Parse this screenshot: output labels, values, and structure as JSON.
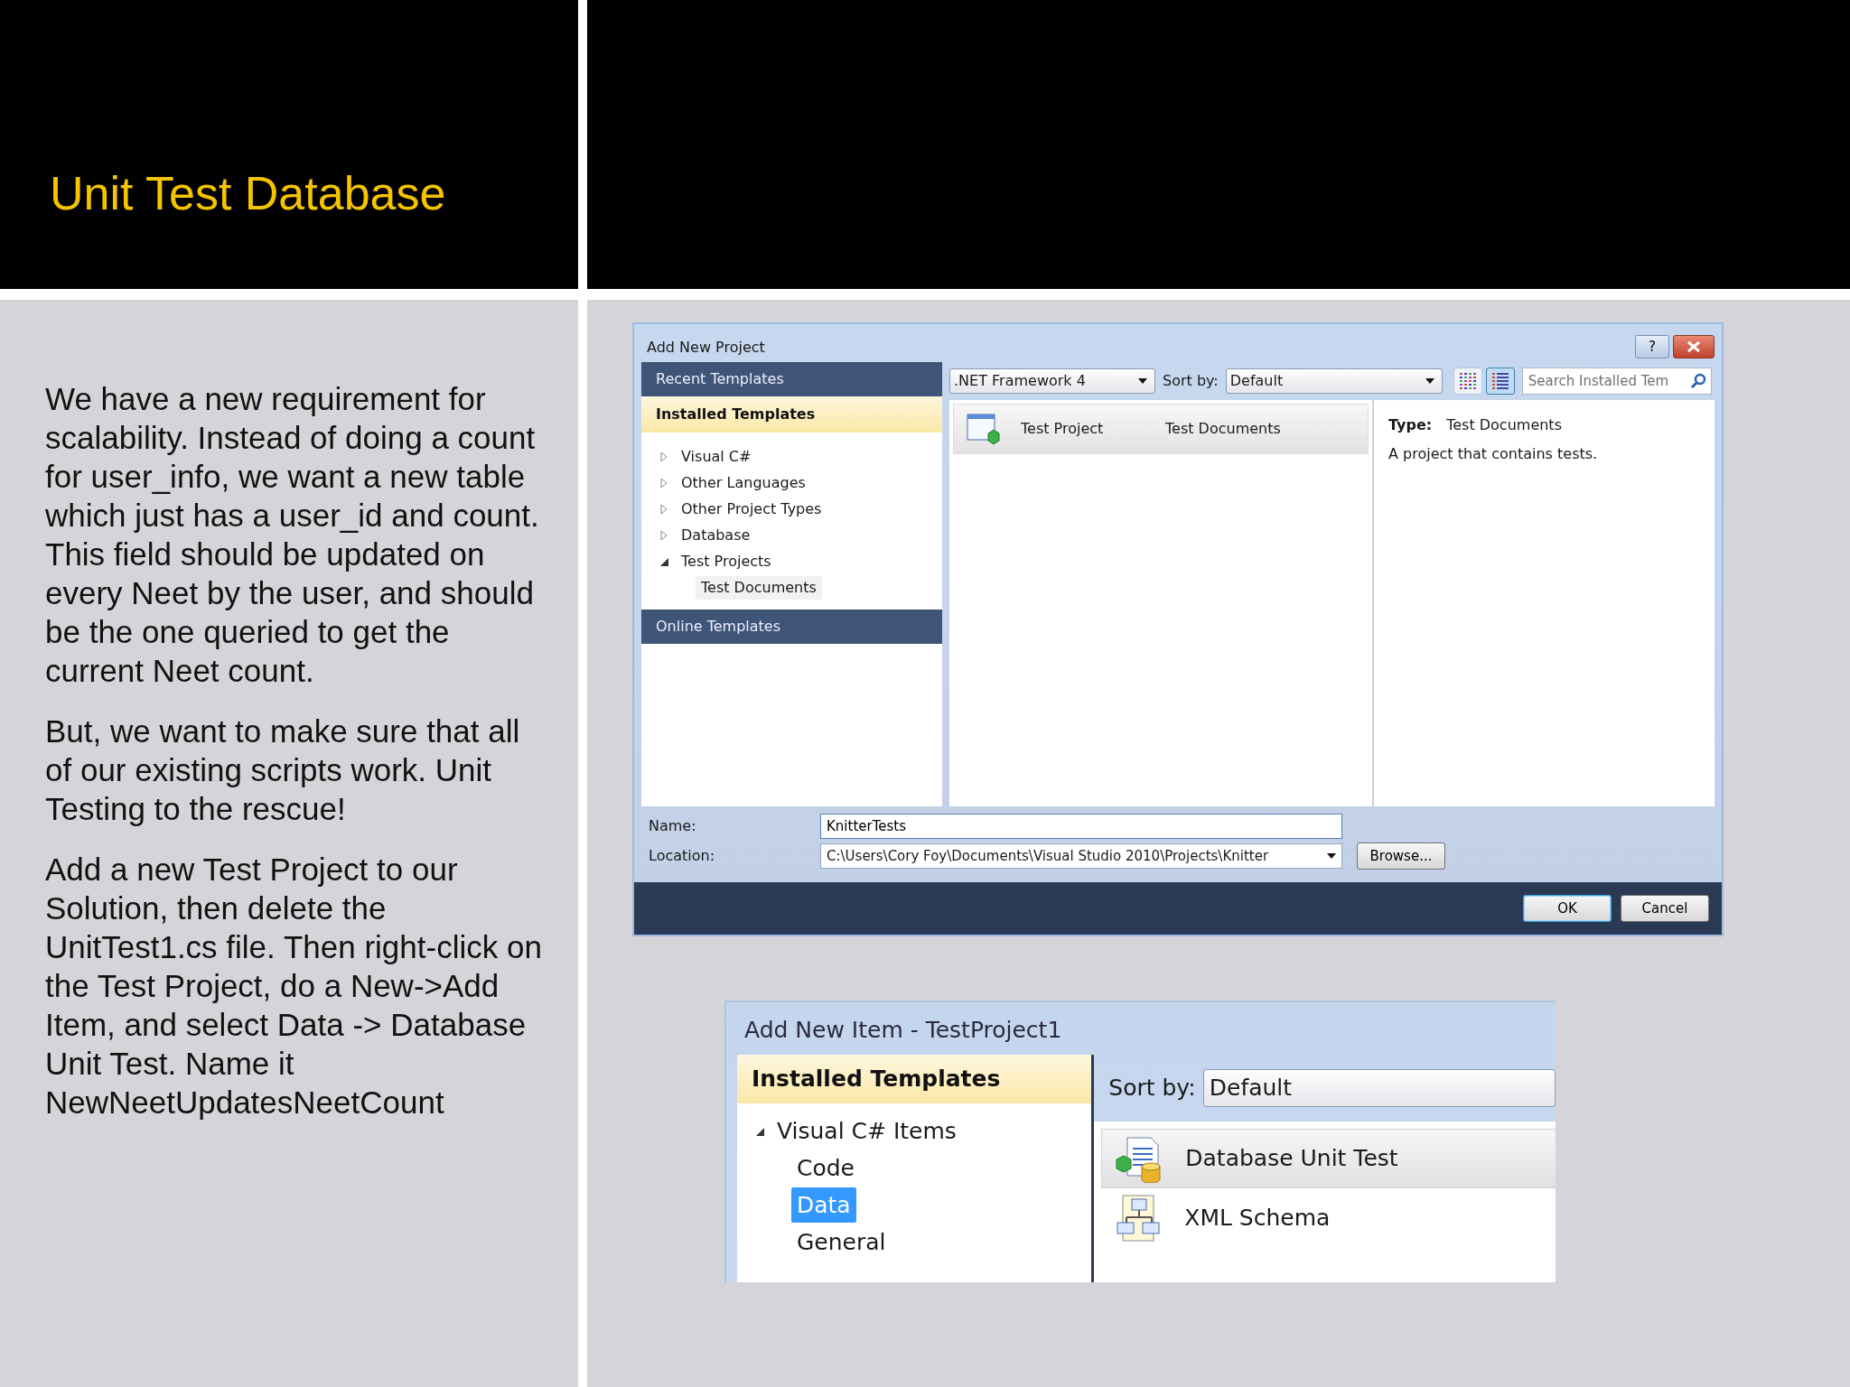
{
  "slide": {
    "title": "Unit Test Database",
    "paragraphs": [
      "We have a new requirement for scalability. Instead of doing a count for user_info, we want a new table which just has a user_id and count. This field should be updated on every Neet by the user, and should be the one queried to get the current Neet count.",
      "But, we want to make sure that all of our existing scripts work. Unit Testing to the rescue!",
      "Add a new Test Project to our Solution, then delete the UnitTest1.cs file. Then right-click on the Test Project, do a New->Add Item, and select Data -> Database Unit Test. Name it NewNeetUpdatesNeetCount"
    ]
  },
  "project_dialog": {
    "title": "Add New Project",
    "help_button": "?",
    "sections": [
      {
        "label": "Recent Templates",
        "selected": false
      },
      {
        "label": "Installed Templates",
        "selected": true
      },
      {
        "label": "Online Templates",
        "selected": false
      }
    ],
    "tree": [
      {
        "label": "Visual C#",
        "expanded": false,
        "selected": false
      },
      {
        "label": "Other Languages",
        "expanded": false,
        "selected": false
      },
      {
        "label": "Other Project Types",
        "expanded": false,
        "selected": false
      },
      {
        "label": "Database",
        "expanded": false,
        "selected": false
      },
      {
        "label": "Test Projects",
        "expanded": true,
        "selected": false,
        "children": [
          {
            "label": "Test Documents",
            "selected": true
          }
        ]
      }
    ],
    "framework": ".NET Framework 4",
    "sort_label": "Sort by:",
    "sort_value": "Default",
    "view_buttons": [
      {
        "kind": "columns",
        "selected": false
      },
      {
        "kind": "list",
        "selected": true
      }
    ],
    "search": {
      "placeholder": "Search Installed Tem"
    },
    "templates": [
      {
        "name": "Test Project",
        "category": "Test Documents",
        "selected": true
      }
    ],
    "details": {
      "type_label": "Type:",
      "type_value": "Test Documents",
      "description": "A project that contains tests."
    },
    "name_label": "Name:",
    "name_value": "KnitterTests",
    "location_label": "Location:",
    "location_value": "C:\\Users\\Cory Foy\\Documents\\Visual Studio 2010\\Projects\\Knitter",
    "buttons": [
      "Browse...",
      "OK",
      "Cancel"
    ]
  },
  "item_dialog": {
    "title": "Add New Item - TestProject1",
    "section": "Installed Templates",
    "tree": [
      {
        "label": "Visual C# Items",
        "expanded": true,
        "selected": false,
        "children": [
          {
            "label": "Code",
            "selected": false
          },
          {
            "label": "Data",
            "selected": true
          },
          {
            "label": "General",
            "selected": false
          }
        ]
      }
    ],
    "sort_label": "Sort by:",
    "sort_value": "Default",
    "items": [
      {
        "name": "Database Unit Test",
        "kind": "database-test",
        "selected": true
      },
      {
        "name": "XML Schema",
        "kind": "xml-schema",
        "selected": false
      }
    ]
  }
}
